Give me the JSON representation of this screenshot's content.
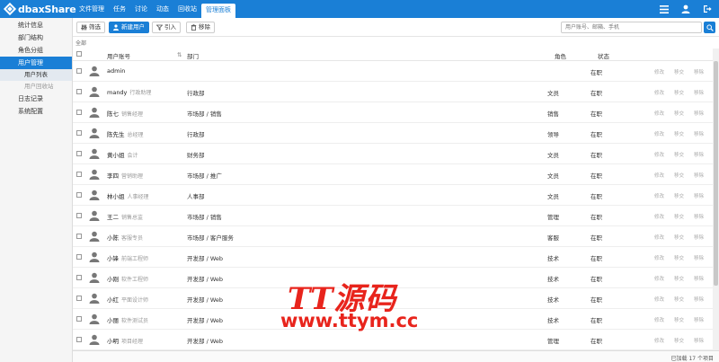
{
  "app": {
    "logo": "dbaxShare"
  },
  "nav": {
    "tabs": [
      "文件管理",
      "任务",
      "讨论",
      "动态",
      "回收站",
      "管理面板"
    ],
    "active": 5
  },
  "sidebar": {
    "items": [
      "统计信息",
      "部门结构",
      "角色分组",
      "用户管理"
    ],
    "subitems": [
      "用户列表",
      "用户回收站"
    ],
    "items2": [
      "日志记录",
      "系统配置"
    ]
  },
  "toolbar": {
    "filter": "筛选",
    "new_user": "新建用户",
    "import": "引入",
    "remove": "移除",
    "search_placeholder": "用户账号、邮箱、手机"
  },
  "breadcrumb": "全部",
  "table": {
    "headers": {
      "account": "用户账号",
      "dept": "部门",
      "role": "角色",
      "status": "状态"
    },
    "actions": [
      "修改",
      "移交",
      "移除"
    ],
    "rows": [
      {
        "name": "admin",
        "title": "",
        "dept": "",
        "role": "",
        "status": "在职"
      },
      {
        "name": "mandy",
        "title": "行政助理",
        "dept": "行政部",
        "role": "文员",
        "status": "在职"
      },
      {
        "name": "陈七",
        "title": "销售经理",
        "dept": "市场部 / 销售",
        "role": "销售",
        "status": "在职"
      },
      {
        "name": "陈先生",
        "title": "总经理",
        "dept": "行政部",
        "role": "领导",
        "status": "在职"
      },
      {
        "name": "黄小姐",
        "title": "会计",
        "dept": "财务部",
        "role": "文员",
        "status": "在职"
      },
      {
        "name": "李四",
        "title": "营销助理",
        "dept": "市场部 / 推广",
        "role": "文员",
        "status": "在职"
      },
      {
        "name": "林小姐",
        "title": "人事经理",
        "dept": "人事部",
        "role": "文员",
        "status": "在职"
      },
      {
        "name": "王二",
        "title": "销售总监",
        "dept": "市场部 / 销售",
        "role": "管理",
        "status": "在职"
      },
      {
        "name": "小陈",
        "title": "客服专员",
        "dept": "市场部 / 客户服务",
        "role": "客服",
        "status": "在职"
      },
      {
        "name": "小锋",
        "title": "前端工程师",
        "dept": "开发部 / Web",
        "role": "技术",
        "status": "在职"
      },
      {
        "name": "小刚",
        "title": "软件工程师",
        "dept": "开发部 / Web",
        "role": "技术",
        "status": "在职"
      },
      {
        "name": "小红",
        "title": "平面设计师",
        "dept": "开发部 / Web",
        "role": "技术",
        "status": "在职"
      },
      {
        "name": "小丽",
        "title": "软件测试员",
        "dept": "开发部 / Web",
        "role": "技术",
        "status": "在职"
      },
      {
        "name": "小明",
        "title": "项目经理",
        "dept": "开发部 / Web",
        "role": "管理",
        "status": "在职"
      }
    ]
  },
  "footer": {
    "loaded": "已加载 17 个项目"
  },
  "watermark": {
    "title": "TT源码",
    "url": "www.ttym.cc"
  },
  "colors": {
    "accent": "#1a7fd6",
    "watermark": "#e8241c"
  }
}
